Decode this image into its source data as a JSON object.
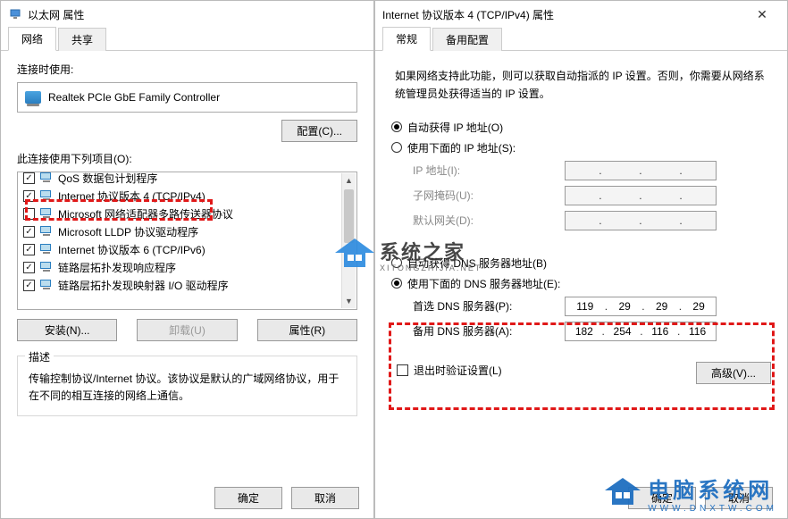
{
  "left": {
    "title": "以太网 属性",
    "tabs": {
      "network": "网络",
      "share": "共享"
    },
    "connect_label": "连接时使用:",
    "adapter": "Realtek PCIe GbE Family Controller",
    "configure_btn": "配置(C)...",
    "items_label": "此连接使用下列项目(O):",
    "items": [
      {
        "checked": true,
        "label": "QoS 数据包计划程序"
      },
      {
        "checked": true,
        "label": "Internet 协议版本 4 (TCP/IPv4)"
      },
      {
        "checked": false,
        "label": "Microsoft 网络适配器多路传送器协议"
      },
      {
        "checked": true,
        "label": "Microsoft LLDP 协议驱动程序"
      },
      {
        "checked": true,
        "label": "Internet 协议版本 6 (TCP/IPv6)"
      },
      {
        "checked": true,
        "label": "链路层拓扑发现响应程序"
      },
      {
        "checked": true,
        "label": "链路层拓扑发现映射器 I/O 驱动程序"
      }
    ],
    "install_btn": "安装(N)...",
    "uninstall_btn": "卸载(U)",
    "properties_btn": "属性(R)",
    "desc_title": "描述",
    "desc_text": "传输控制协议/Internet 协议。该协议是默认的广域网络协议，用于在不同的相互连接的网络上通信。",
    "ok_btn": "确定",
    "cancel_btn": "取消"
  },
  "right": {
    "title": "Internet 协议版本 4 (TCP/IPv4) 属性",
    "tabs": {
      "general": "常规",
      "alt": "备用配置"
    },
    "intro": "如果网络支持此功能，则可以获取自动指派的 IP 设置。否则，你需要从网络系统管理员处获得适当的 IP 设置。",
    "ip_auto": "自动获得 IP 地址(O)",
    "ip_manual": "使用下面的 IP 地址(S):",
    "ip_label": "IP 地址(I):",
    "mask_label": "子网掩码(U):",
    "gw_label": "默认网关(D):",
    "dns_auto": "自动获得 DNS 服务器地址(B)",
    "dns_manual": "使用下面的 DNS 服务器地址(E):",
    "dns1_label": "首选 DNS 服务器(P):",
    "dns2_label": "备用 DNS 服务器(A):",
    "dns1": [
      "119",
      "29",
      "29",
      "29"
    ],
    "dns2": [
      "182",
      "254",
      "116",
      "116"
    ],
    "validate": "退出时验证设置(L)",
    "advanced_btn": "高级(V)...",
    "ok_btn": "确定",
    "cancel_btn": "取消"
  },
  "watermark1": {
    "name": "系统之家",
    "sub": "XITONGZHIJIA.NET"
  },
  "watermark2": {
    "name": "电脑系统网",
    "sub": "WWW.DNXTW.COM"
  }
}
